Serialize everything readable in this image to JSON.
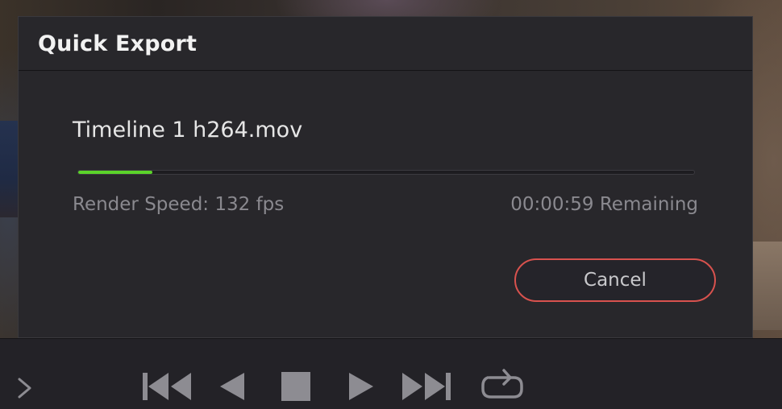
{
  "dialog": {
    "title": "Quick Export",
    "filename": "Timeline 1 h264.mov",
    "progress_fraction": 0.12,
    "render_speed": "Render Speed: 132 fps",
    "remaining": "00:00:59 Remaining",
    "cancel_label": "Cancel"
  },
  "transport": {
    "controls": [
      {
        "name": "expand-chevron-icon"
      },
      {
        "name": "go-to-start-icon"
      },
      {
        "name": "play-reverse-icon"
      },
      {
        "name": "stop-icon"
      },
      {
        "name": "play-icon"
      },
      {
        "name": "go-to-end-icon"
      },
      {
        "name": "loop-icon"
      }
    ]
  },
  "colors": {
    "accent_progress": "#5bd32a",
    "cancel_border": "#d8524e",
    "dialog_bg": "#28272b"
  }
}
